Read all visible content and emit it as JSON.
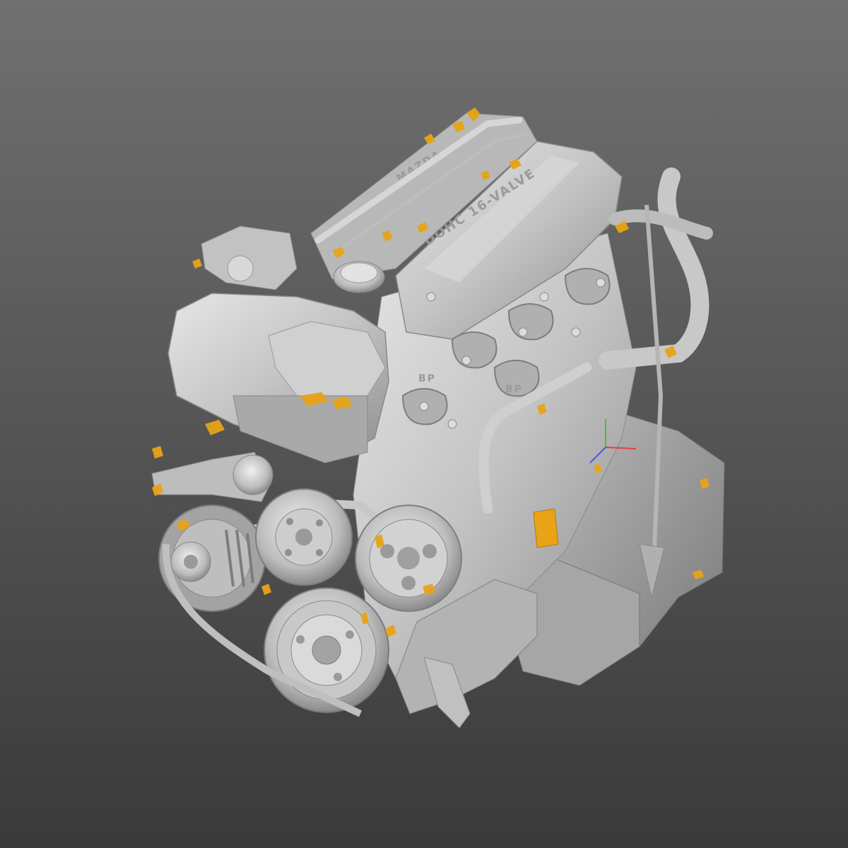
{
  "viewer": {
    "background_top": "#707070",
    "background_bottom": "#3a3a3a",
    "model_color": "#c8c8c8",
    "highlight_color": "#e8a316"
  },
  "model": {
    "cover_text": "DOHC 16-VALVE",
    "cam_cover_text": "MAZDA",
    "manifold_text_1": "BP",
    "manifold_text_2": "BP"
  },
  "axis": {
    "x_color": "#e04040",
    "y_color": "#40c040",
    "z_color": "#4060e0"
  }
}
